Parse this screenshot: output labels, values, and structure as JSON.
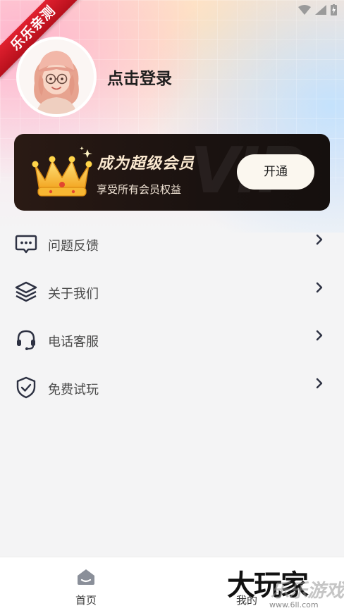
{
  "ribbon": {
    "text": "乐乐亲测"
  },
  "profile": {
    "login_text": "点击登录"
  },
  "vip": {
    "title": "成为超级会员",
    "subtitle": "享受所有会员权益",
    "button": "开通",
    "watermark": "VIP"
  },
  "menu": {
    "items": [
      {
        "label": "问题反馈",
        "icon": "feedback-chat-icon"
      },
      {
        "label": "关于我们",
        "icon": "layers-icon"
      },
      {
        "label": "电话客服",
        "icon": "headset-icon"
      },
      {
        "label": "免费试玩",
        "icon": "shield-check-icon"
      }
    ]
  },
  "tabbar": {
    "home_label": "首页",
    "mine_label": "我的"
  },
  "watermark": {
    "brand": "大玩家",
    "brand_overlay": "乐乐游戏",
    "url": "www.6ll.com"
  },
  "colors": {
    "ribbon": "#d4161f",
    "vip_card": "#1a1210",
    "vip_text": "#fbe9d0",
    "menu_text": "#4a4a4a",
    "icon_stroke": "#2d3142",
    "page_bg": "#f4f4f5"
  }
}
